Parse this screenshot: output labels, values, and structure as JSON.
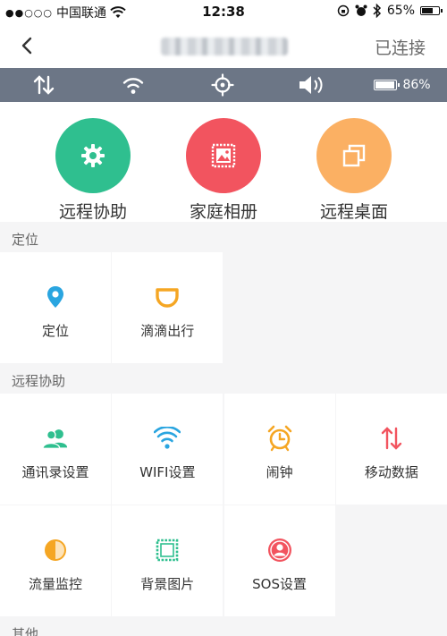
{
  "status_bar": {
    "carrier_dots": "●●○○○",
    "carrier": "中国联通",
    "time": "12:38",
    "battery_pct": "65%"
  },
  "nav": {
    "connection_status": "已连接"
  },
  "device_strip": {
    "battery_pct": "86%",
    "icons": [
      "data-arrows-icon",
      "wifi-icon",
      "gps-target-icon",
      "volume-icon",
      "battery-icon"
    ]
  },
  "quick_actions": [
    {
      "label": "远程协助",
      "color": "#2fbf8f",
      "icon": "gear-icon"
    },
    {
      "label": "家庭相册",
      "color": "#f2545f",
      "icon": "photo-icon"
    },
    {
      "label": "远程桌面",
      "color": "#fbb063",
      "icon": "desktop-icon"
    }
  ],
  "sections": [
    {
      "title": "定位",
      "items": [
        {
          "label": "定位",
          "icon": "location-pin-icon",
          "color": "#2aa5e0"
        },
        {
          "label": "滴滴出行",
          "icon": "didi-icon",
          "color": "#f5a623"
        }
      ]
    },
    {
      "title": "远程协助",
      "items": [
        {
          "label": "通讯录设置",
          "icon": "contacts-icon",
          "color": "#2fbf8f"
        },
        {
          "label": "WIFI设置",
          "icon": "wifi-icon",
          "color": "#2aa5e0"
        },
        {
          "label": "闹钟",
          "icon": "alarm-clock-icon",
          "color": "#f5a623"
        },
        {
          "label": "移动数据",
          "icon": "mobile-data-icon",
          "color": "#f2545f"
        },
        {
          "label": "流量监控",
          "icon": "pie-chart-icon",
          "color": "#f5a623"
        },
        {
          "label": "背景图片",
          "icon": "image-frame-icon",
          "color": "#2fbf8f"
        },
        {
          "label": "SOS设置",
          "icon": "sos-user-icon",
          "color": "#f2545f"
        }
      ]
    },
    {
      "title": "其他",
      "items": []
    }
  ]
}
